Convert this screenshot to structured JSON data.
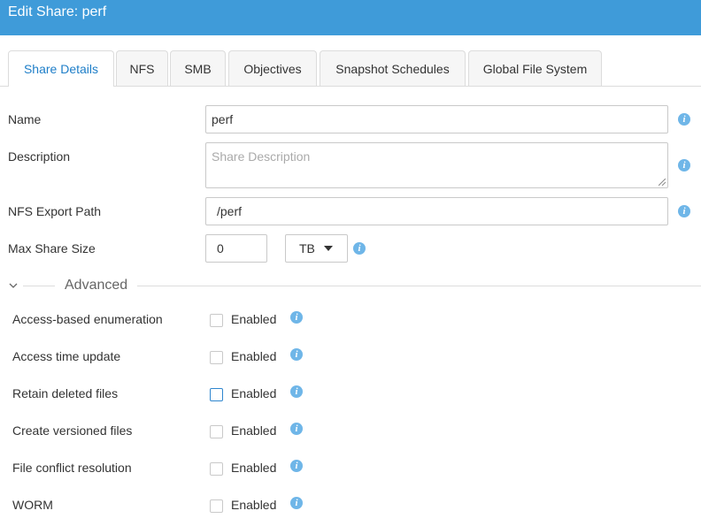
{
  "window": {
    "title": "Edit Share: perf"
  },
  "tabs": [
    {
      "label": "Share Details",
      "active": true
    },
    {
      "label": "NFS"
    },
    {
      "label": "SMB"
    },
    {
      "label": "Objectives"
    },
    {
      "label": "Snapshot Schedules"
    },
    {
      "label": "Global File System"
    }
  ],
  "form": {
    "name": {
      "label": "Name",
      "value": "perf"
    },
    "description": {
      "label": "Description",
      "placeholder": "Share Description",
      "value": ""
    },
    "nfs_export_path": {
      "label": "NFS Export Path",
      "value": "/perf"
    },
    "max_share_size": {
      "label": "Max Share Size",
      "value": "0",
      "unit": "TB"
    }
  },
  "advanced": {
    "label": "Advanced",
    "expanded": true,
    "options": [
      {
        "label": "Access-based enumeration",
        "checkbox_label": "Enabled",
        "checked": false
      },
      {
        "label": "Access time update",
        "checkbox_label": "Enabled",
        "checked": false
      },
      {
        "label": "Retain deleted files",
        "checkbox_label": "Enabled",
        "checked": false,
        "focused": true
      },
      {
        "label": "Create versioned files",
        "checkbox_label": "Enabled",
        "checked": false
      },
      {
        "label": "File conflict resolution",
        "checkbox_label": "Enabled",
        "checked": false
      },
      {
        "label": "WORM",
        "checkbox_label": "Enabled",
        "checked": false
      }
    ]
  },
  "colors": {
    "titlebar": "#3f9bd9",
    "active_tab_text": "#1e7ec8",
    "info_icon": "#6fb6e8"
  },
  "icons": {
    "info": "info-icon",
    "advanced_toggle": "chevron-down-icon",
    "select_caret": "caret-down-icon",
    "textarea_resize": "resize-grip-icon"
  }
}
